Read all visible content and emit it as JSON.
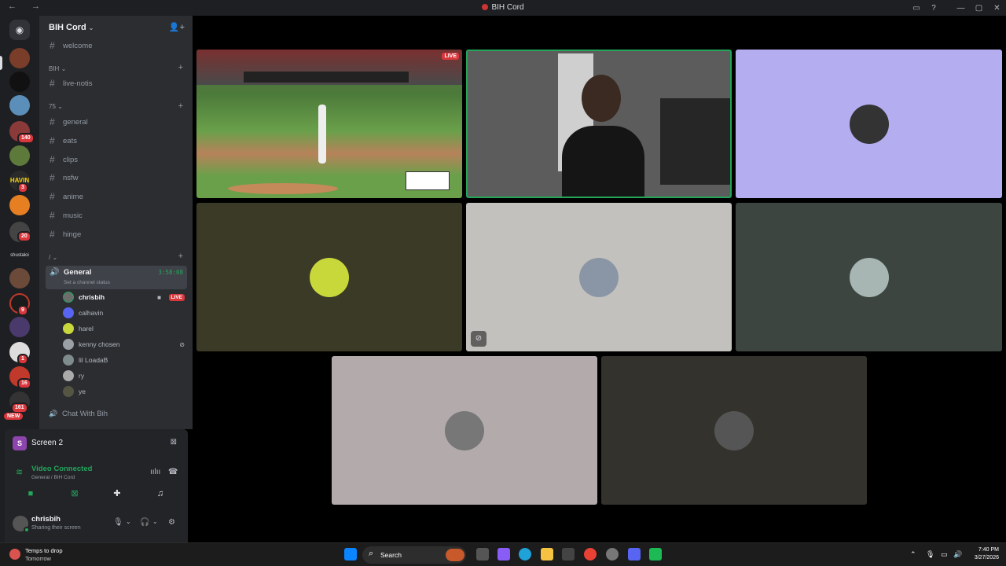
{
  "window": {
    "title": "BIH Cord"
  },
  "guild": {
    "name": "BIH Cord"
  },
  "channels": {
    "top": [
      {
        "name": "welcome"
      }
    ],
    "cat_bih": {
      "name": "BIH",
      "items": [
        {
          "name": "live-notis"
        }
      ]
    },
    "cat_75": {
      "name": "75",
      "items": [
        {
          "name": "general"
        },
        {
          "name": "eats"
        },
        {
          "name": "clips"
        },
        {
          "name": "nsfw"
        },
        {
          "name": "anime"
        },
        {
          "name": "music"
        },
        {
          "name": "hinge"
        }
      ]
    },
    "cat_slash": {
      "name": "/"
    }
  },
  "voice": {
    "name": "General",
    "status": "Set a channel status",
    "timer": "3:58:08",
    "live_label": "LIVE",
    "users": [
      {
        "name": "chrisbih"
      },
      {
        "name": "calhavin"
      },
      {
        "name": "harel"
      },
      {
        "name": "kenny chosen"
      },
      {
        "name": "lil LoadaB"
      },
      {
        "name": "ry"
      },
      {
        "name": "ye"
      }
    ],
    "other_channel": "Chat With Bih"
  },
  "rail": {
    "badges": [
      "140",
      "3",
      "20",
      "9",
      "1",
      "16",
      "161"
    ],
    "new_label": "NEW"
  },
  "screen_panel": {
    "title": "Screen 2"
  },
  "connection": {
    "title": "Video Connected",
    "subtitle": "General / BIH Cord"
  },
  "user_panel": {
    "name": "chrisbih",
    "status": "Sharing their screen"
  },
  "stage": {
    "live_label": "LIVE"
  },
  "taskbar": {
    "weather_line1": "Temps to drop",
    "weather_line2": "Tomorrow",
    "search_label": "Search",
    "time": "7:40 PM",
    "date": "3/27/2026"
  }
}
